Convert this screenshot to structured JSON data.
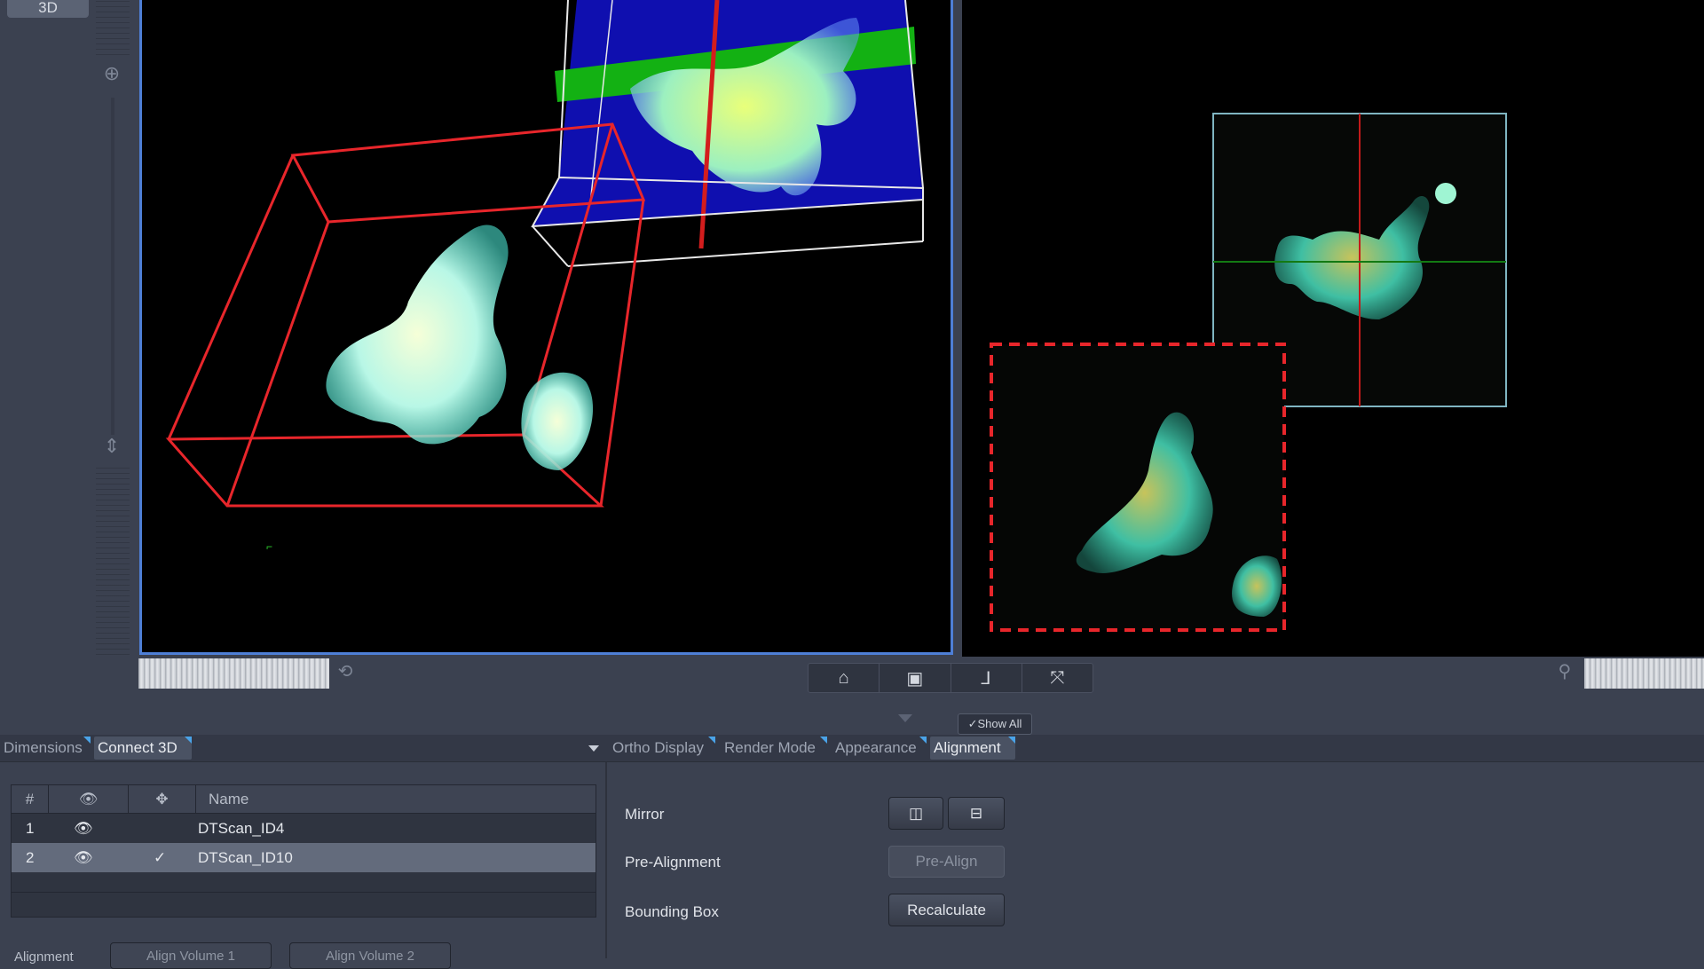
{
  "left_toolbar": {
    "tab_3d_label": "3D",
    "zoom_icon": "zoom-in-icon",
    "move_icon": "pan-icon"
  },
  "viewports": {
    "view_3d": "3d-render-viewport",
    "view_ortho": "ortho-viewport"
  },
  "view_toolbar": {
    "buttons": [
      "home-icon",
      "box-view-icon",
      "axes-icon",
      "reset-view-icon"
    ]
  },
  "show_all_label": "✓Show All",
  "tabs_left": {
    "dimensions": "Dimensions",
    "connect3d": "Connect 3D"
  },
  "tabs_right": {
    "ortho_display": "Ortho Display",
    "render_mode": "Render Mode",
    "appearance": "Appearance",
    "alignment": "Alignment"
  },
  "table": {
    "headers": {
      "num": "#",
      "name": "Name"
    },
    "rows": [
      {
        "num": "1",
        "name": "DTScan_ID4",
        "checked": ""
      },
      {
        "num": "2",
        "name": "DTScan_ID10",
        "checked": "✓"
      }
    ]
  },
  "bottom_left": {
    "alignment_label": "Alignment",
    "align_volume_1": "Align Volume 1",
    "align_volume_2": "Align Volume 2"
  },
  "alignment_panel": {
    "mirror_label": "Mirror",
    "pre_alignment_label": "Pre-Alignment",
    "pre_align_button": "Pre-Align",
    "bounding_box_label": "Bounding Box",
    "recalculate_button": "Recalculate"
  },
  "colors": {
    "accent_blue": "#4e7fd6",
    "tab_corner": "#4aa3e8",
    "box_red": "#e8262b"
  }
}
